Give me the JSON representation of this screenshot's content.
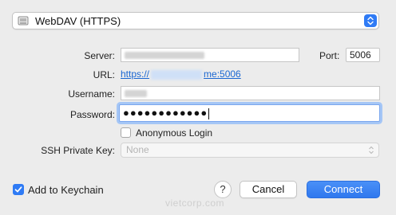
{
  "protocol": {
    "selected": "WebDAV (HTTPS)",
    "icon": "drive-icon"
  },
  "server": {
    "label": "Server:",
    "value": "",
    "port_label": "Port:",
    "port_value": "5006"
  },
  "url": {
    "label": "URL:",
    "prefix": "https://",
    "suffix": "me:5006"
  },
  "username": {
    "label": "Username:",
    "value": ""
  },
  "password": {
    "label": "Password:",
    "masked": "●●●●●●●●●●●●"
  },
  "anonymous": {
    "label": "Anonymous Login",
    "checked": false
  },
  "ssh": {
    "label": "SSH Private Key:",
    "value": "None",
    "disabled": true
  },
  "keychain": {
    "label": "Add to Keychain",
    "checked": true
  },
  "buttons": {
    "help": "?",
    "cancel": "Cancel",
    "connect": "Connect"
  },
  "watermark": "vietcorp.com",
  "colors": {
    "accent": "#2f7bf5",
    "link": "#1a67d2",
    "focus_ring": "#a5c6f6"
  }
}
